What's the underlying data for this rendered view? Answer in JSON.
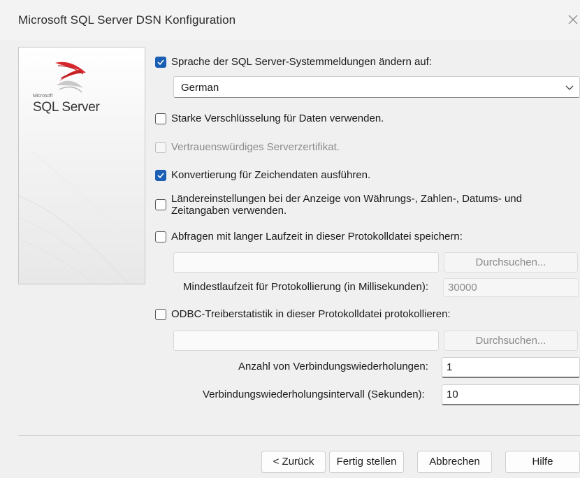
{
  "window": {
    "title": "Microsoft SQL Server DSN Konfiguration"
  },
  "banner": {
    "logo_small": "Microsoft",
    "logo_text": "SQL Server"
  },
  "options": {
    "change_language": {
      "label": "Sprache der SQL Server-Systemmeldungen ändern auf:",
      "checked": true
    },
    "language_select": {
      "value": "German"
    },
    "strong_encryption": {
      "label": "Starke Verschlüsselung für Daten verwenden.",
      "checked": false
    },
    "trust_server_cert": {
      "label": "Vertrauenswürdiges Serverzertifikat.",
      "checked": false,
      "disabled": true
    },
    "char_conversion": {
      "label": "Konvertierung für Zeichendaten ausführen.",
      "checked": true
    },
    "regional_settings": {
      "label_line1": "Ländereinstellungen bei der Anzeige von Währungs-, Zahlen-, Datums- und",
      "label_line2": "Zeitangaben verwenden.",
      "checked": false
    },
    "long_queries": {
      "label": "Abfragen mit langer Laufzeit in dieser Protokolldatei speichern:",
      "checked": false
    },
    "long_queries_browse": "Durchsuchen...",
    "min_runtime_label": "Mindestlaufzeit für Protokollierung (in Millisekunden):",
    "min_runtime_value": "30000",
    "odbc_stats": {
      "label": "ODBC-Treiberstatistik in dieser Protokolldatei protokollieren:",
      "checked": false
    },
    "odbc_stats_browse": "Durchsuchen...",
    "retry_count_label": "Anzahl von Verbindungswiederholungen:",
    "retry_count_value": "1",
    "retry_interval_label": "Verbindungswiederholungsintervall (Sekunden):",
    "retry_interval_value": "10"
  },
  "footer": {
    "back": "< Zurück",
    "finish": "Fertig stellen",
    "cancel": "Abbrechen",
    "help": "Hilfe"
  },
  "colors": {
    "accent": "#1a5fb4",
    "window_bg": "#f0f0f0"
  }
}
